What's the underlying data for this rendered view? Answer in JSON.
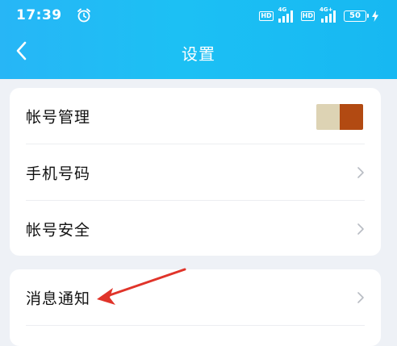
{
  "status_bar": {
    "time": "17:39",
    "hd1": "HD",
    "net1": "4G",
    "hd2": "HD",
    "net2": "4G+",
    "battery": "50",
    "icons": [
      "alarm-icon",
      "signal-icon",
      "battery-icon",
      "charging-bolt-icon"
    ]
  },
  "nav": {
    "title": "设置",
    "back_icon": "chevron-left-icon"
  },
  "settings": {
    "group1": [
      {
        "label": "帐号管理",
        "trailing": "avatar"
      },
      {
        "label": "手机号码",
        "trailing": "chevron-right-icon"
      },
      {
        "label": "帐号安全",
        "trailing": "chevron-right-icon"
      }
    ],
    "group2": [
      {
        "label": "消息通知",
        "trailing": "chevron-right-icon"
      }
    ]
  },
  "colors": {
    "header": "#1cbdf4",
    "background": "#eef1f6",
    "card": "#ffffff",
    "annotation_arrow": "#e0342a",
    "avatar_swatch_a": "#ddd3b4",
    "avatar_swatch_b": "#b24a12"
  }
}
